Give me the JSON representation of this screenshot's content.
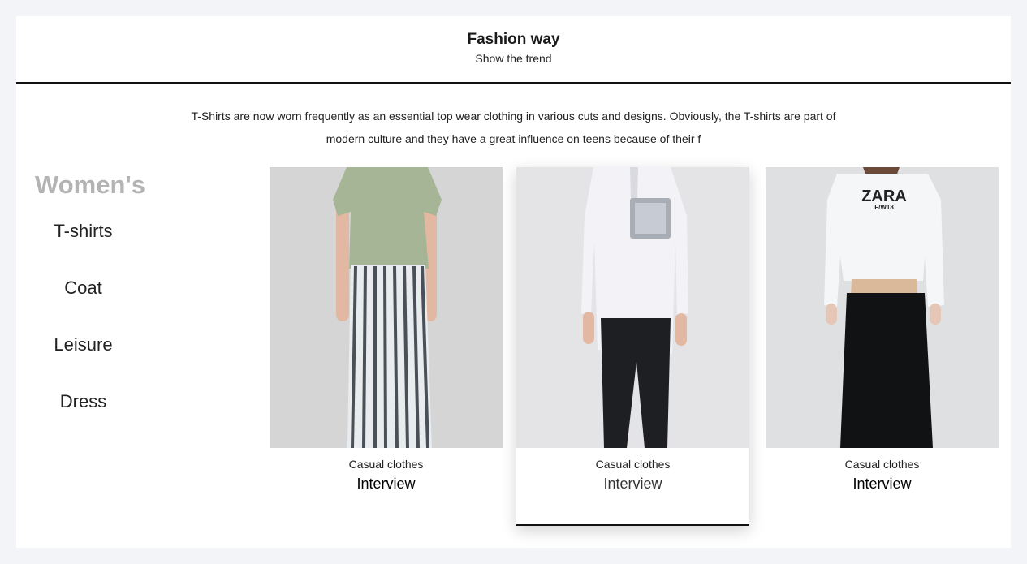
{
  "header": {
    "title": "Fashion way",
    "subtitle": "Show the trend"
  },
  "intro": {
    "line1": "T-Shirts are now worn frequently as an essential top wear clothing in various cuts and designs. Obviously, the T-shirts are part of",
    "line2": "modern culture and they have a great influence on teens because of their f"
  },
  "sidebar": {
    "heading": "Women's",
    "items": [
      {
        "label": "T-shirts"
      },
      {
        "label": "Coat"
      },
      {
        "label": "Leisure"
      },
      {
        "label": "Dress"
      }
    ]
  },
  "cards": [
    {
      "category": "Casual clothes",
      "link": "Interview",
      "image": "model-green-top-striped-skirt"
    },
    {
      "category": "Casual clothes",
      "link": "Interview",
      "image": "model-white-shirt-black-pants"
    },
    {
      "category": "Casual clothes",
      "link": "Interview",
      "image": "model-zara-sweatshirt-black-skirt",
      "print": "ZARA",
      "print_sub": "F/W18"
    }
  ],
  "colors": {
    "background": "#f3f4f8",
    "panel": "#ffffff",
    "heading_muted": "#b3b3b3",
    "divider": "#111111"
  }
}
